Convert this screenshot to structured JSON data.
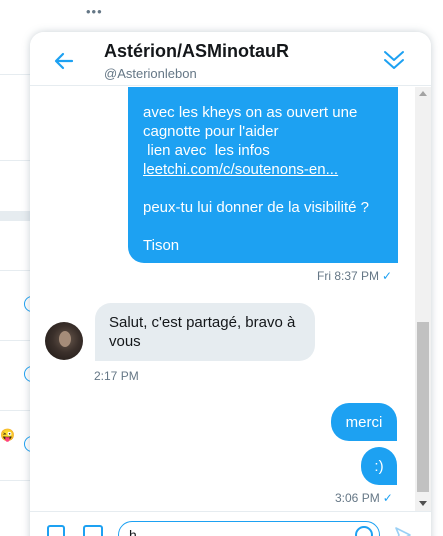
{
  "conversation": {
    "title": "Astérion/ASMinotauR",
    "handle": "@Asterionlebon"
  },
  "messages": {
    "outgoing_long": {
      "line1": "avec les kheys on as ouvert une",
      "line2": "cagnotte pour l'aider",
      "line3": " lien avec  les infos",
      "link": "leetchi.com/c/soutenons-en...",
      "line5": "peux-tu lui donner de la visibilité ?",
      "line6": "Tison",
      "time": "Fri 8:37 PM"
    },
    "incoming": {
      "line1": "Salut, c'est partagé, bravo à",
      "line2": "vous",
      "time": "2:17 PM"
    },
    "outgoing_merci": {
      "text": "merci"
    },
    "outgoing_smile": {
      "text": ":)",
      "time": "3:06 PM"
    }
  },
  "status": {
    "read_check": "✓"
  },
  "background": {
    "more_label": "•••"
  },
  "composer": {
    "value": "h"
  },
  "colors": {
    "accent": "#1da1f2",
    "incoming_bubble": "#e6ecf0",
    "secondary_text": "#657786"
  },
  "icons": [
    "back-arrow-icon",
    "collapse-chevron-icon",
    "media-icon",
    "gif-icon",
    "emoji-icon",
    "send-icon",
    "read-check-icon"
  ]
}
